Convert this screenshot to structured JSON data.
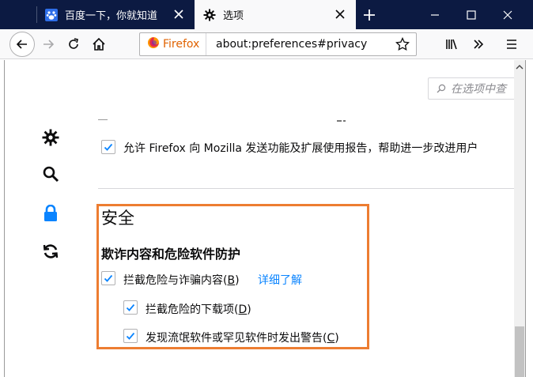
{
  "tabs": [
    {
      "title": "百度一下，你就知道",
      "icon": "baidu-paw-icon",
      "active": false
    },
    {
      "title": "选项",
      "icon": "gear-icon",
      "active": true
    }
  ],
  "toolbar": {
    "identity_label": "Firefox",
    "url": "about:preferences#privacy"
  },
  "search": {
    "placeholder": "在选项中查"
  },
  "content": {
    "telemetry_label": "允许 Firefox 向 Mozilla 发送功能及扩展使用报告，帮助进一步改进用户",
    "section_title": "安全",
    "group_title": "欺诈内容和危险软件防护",
    "options": [
      {
        "pre": "拦截危险与诈骗内容(",
        "key": "B",
        "post": ")",
        "checked": true
      },
      {
        "pre": "拦截危险的下载项(",
        "key": "D",
        "post": ")",
        "checked": true
      },
      {
        "pre": "发现流氓软件或罕见软件时发出警告(",
        "key": "C",
        "post": ")",
        "checked": true
      }
    ],
    "learn_more": "详细了解"
  },
  "categories": [
    "gear-icon",
    "search-icon",
    "lock-icon",
    "sync-icon"
  ],
  "colors": {
    "titlebar": "#0c1a42",
    "accent": "#0a84ff",
    "highlight": "#ed7d31"
  }
}
